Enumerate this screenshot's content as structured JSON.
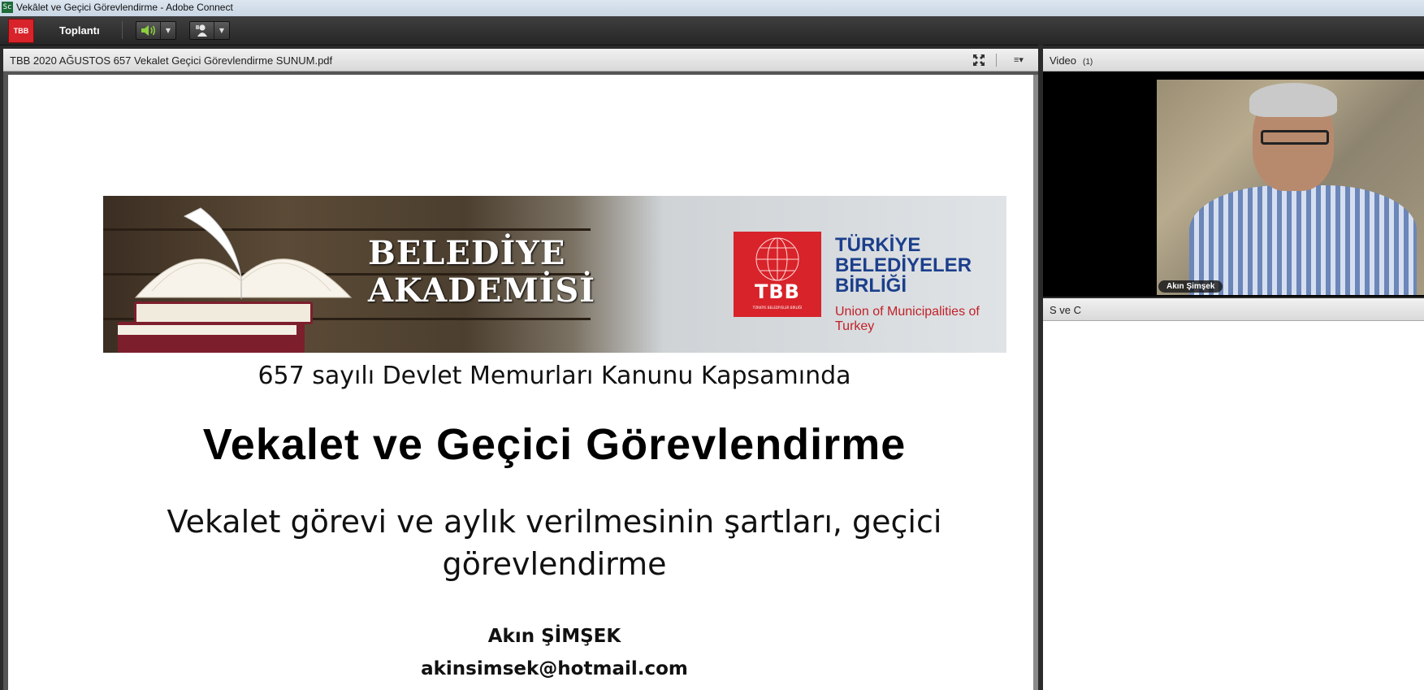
{
  "window": {
    "title": "Vekâlet ve Geçici Görevlendirme - Adobe Connect",
    "icon": "adobe-connect-icon"
  },
  "menubar": {
    "logo": "TBB",
    "meeting_menu": "Toplantı",
    "speaker_icon": "speaker-icon",
    "camera_icon": "webcam-icon",
    "accent_color": "#8ccf3c"
  },
  "share_pod": {
    "filename": "TBB 2020 AĞUSTOS 657 Vekalet Geçici Görevlendirme SUNUM.pdf",
    "slide": {
      "banner_title_line1": "BELEDİYE",
      "banner_title_line2": "AKADEMİSİ",
      "logo_text": "TBB",
      "logo_subtext": "TÜRKİYE BELEDİYELER BİRLİĞİ",
      "org_line1": "TÜRKİYE",
      "org_line2": "BELEDİYELER",
      "org_line3": "BİRLİĞİ",
      "org_english": "Union of Municipalities of Turkey",
      "subtitle": "657 sayılı Devlet Memurları Kanunu Kapsamında",
      "title": "Vekalet ve Geçici Görevlendirme",
      "description": "Vekalet görevi ve aylık verilmesinin şartları, geçici görevlendirme",
      "author": "Akın ŞİMŞEK",
      "email": "akinsimsek@hotmail.com"
    }
  },
  "video_pod": {
    "title": "Video",
    "count": "(1)",
    "participant": "Akın Şimşek"
  },
  "qa_pod": {
    "title": "S ve C"
  }
}
